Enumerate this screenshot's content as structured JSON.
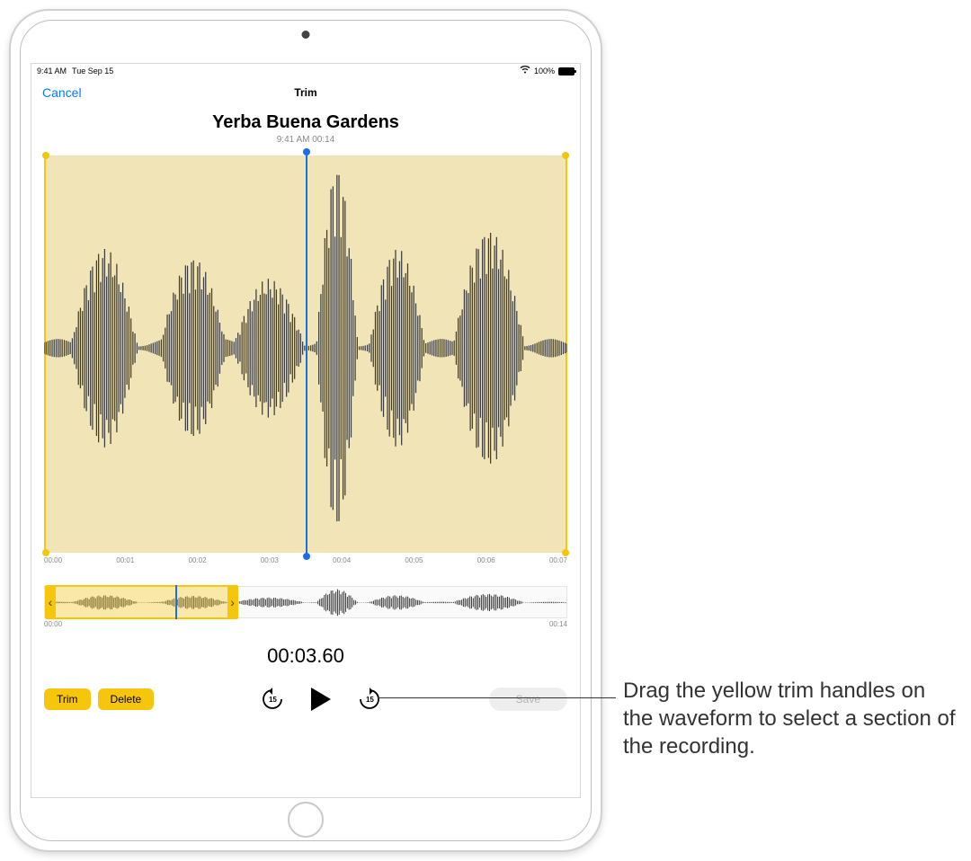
{
  "statusbar": {
    "time": "9:41 AM",
    "date": "Tue Sep 15",
    "battery_pct": "100%"
  },
  "nav": {
    "cancel": "Cancel",
    "title": "Trim"
  },
  "recording": {
    "title": "Yerba Buena Gardens",
    "subtitle": "9:41 AM  00:14"
  },
  "ruler_ticks": [
    "00:00",
    "00:01",
    "00:02",
    "00:03",
    "00:04",
    "00:05",
    "00:06",
    "00:07"
  ],
  "overview": {
    "start_label": "00:00",
    "end_label": "00:14"
  },
  "time_readout": "00:03.60",
  "buttons": {
    "trim": "Trim",
    "delete": "Delete",
    "save": "Save",
    "skip_amount": "15"
  },
  "callout": "Drag the yellow trim handles on the waveform to select a section of the recording."
}
